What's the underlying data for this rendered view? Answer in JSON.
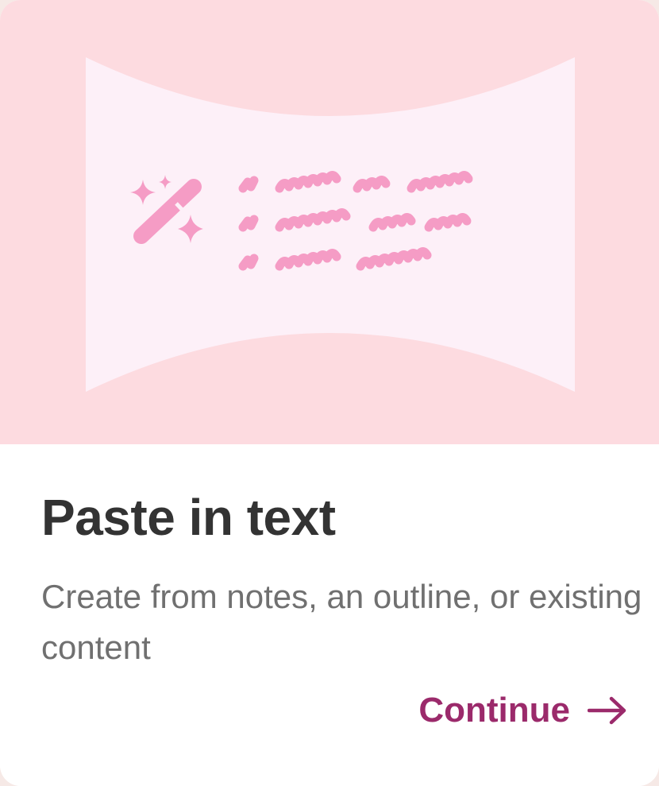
{
  "card": {
    "title": "Paste in text",
    "description": "Create from notes, an outline, or existing content",
    "continue_label": "Continue",
    "continue_icon": "arrow-right-icon",
    "illustration_icons": [
      "magic-wand-icon",
      "sparkles-icon",
      "scribbled-text-lines"
    ]
  },
  "colors": {
    "hero_bg": "#fddbe0",
    "panel_bg": "#fdf0f8",
    "accent_pink": "#f59cc5",
    "link": "#9b2a6b",
    "title": "#333333",
    "description": "#707070"
  }
}
